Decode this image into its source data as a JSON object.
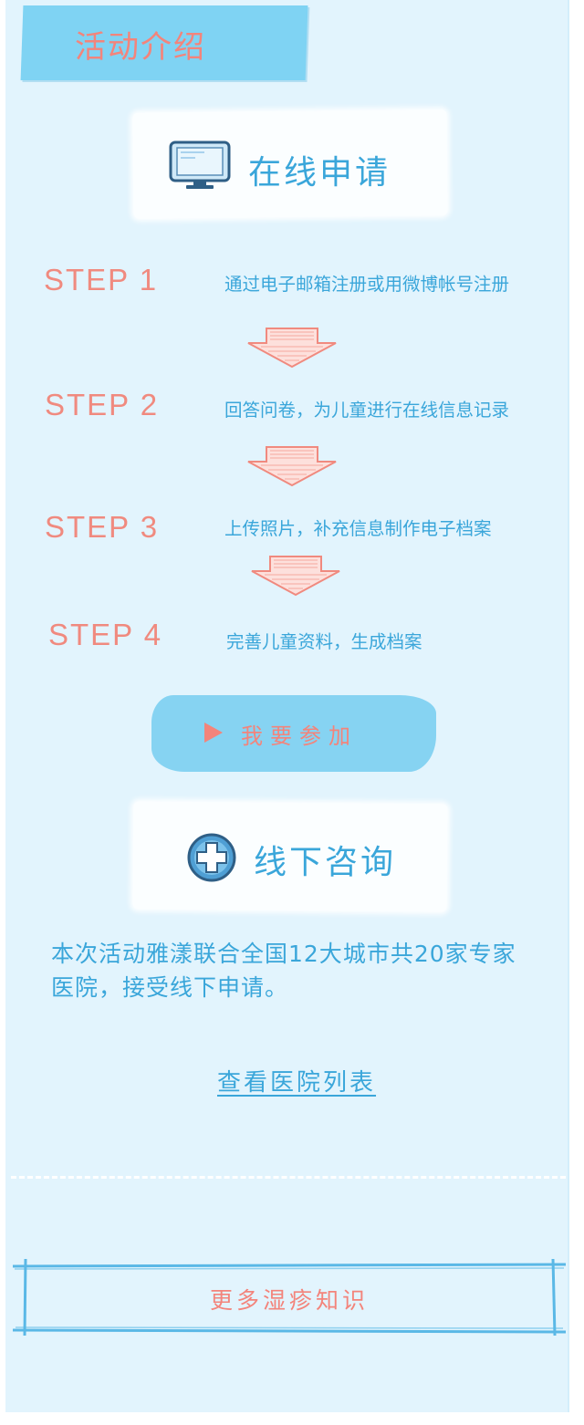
{
  "header": {
    "title": "活动介绍"
  },
  "online_section": {
    "title": "在线申请",
    "icon": "monitor-icon"
  },
  "steps": [
    {
      "label": "STEP 1",
      "text": "通过电子邮箱注册或用微博帐号注册"
    },
    {
      "label": "STEP 2",
      "text": "回答问卷，为儿童进行在线信息记录"
    },
    {
      "label": "STEP 3",
      "text": "上传照片，补充信息制作电子档案"
    },
    {
      "label": "STEP 4",
      "text": "完善儿童资料，生成档案"
    }
  ],
  "join_button": {
    "label": "我要参加",
    "icon": "play-icon"
  },
  "offline_section": {
    "title": "线下咨询",
    "icon": "medical-cross-icon",
    "description": "本次活动雅漾联合全国12大城市共20家专家医院，接受线下申请。",
    "link": "查看医院列表"
  },
  "more_button": {
    "label": "更多湿疹知识"
  },
  "colors": {
    "accent_blue": "#3aa6da",
    "accent_coral": "#f3847b",
    "background": "#e2f4fd",
    "tab": "#7fd3f3"
  }
}
